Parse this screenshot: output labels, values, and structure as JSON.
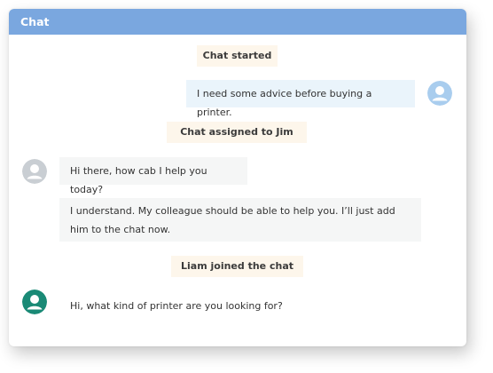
{
  "window": {
    "title": "Chat"
  },
  "messages": {
    "system_started": "Chat started",
    "user_1": "I need some advice before buying a printer.",
    "system_assigned": "Chat assigned to Jim",
    "agent_1": "Hi there, how cab I help you today?",
    "agent_2": "I understand. My colleague should be able to help you. I’ll just add him to the chat now.",
    "system_joined": "Liam joined the chat",
    "agent_3": "Hi, what kind of printer are you looking for?"
  },
  "colors": {
    "header": "#7aa7df",
    "user_avatar": "#a9cdee",
    "agent_avatar": "#c9ced3",
    "new_agent_avatar": "#1a8a76",
    "system_bubble": "#fdf6eb",
    "user_bubble": "#eaf4fb",
    "agent_bubble": "#f5f6f6"
  },
  "icons": {
    "user_avatar": "user-avatar-icon",
    "agent_avatar": "agent-avatar-icon",
    "new_agent_avatar": "new-agent-avatar-icon"
  }
}
